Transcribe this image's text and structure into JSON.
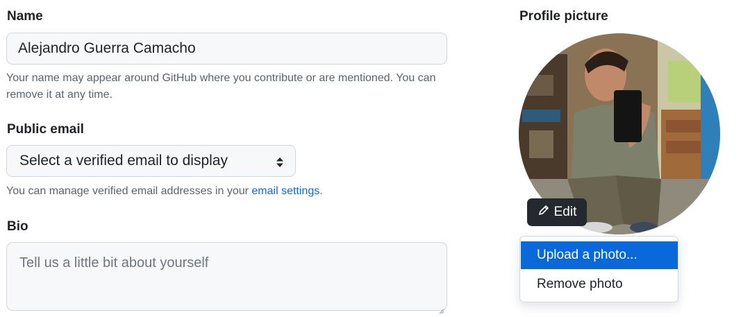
{
  "name_section": {
    "label": "Name",
    "value": "Alejandro Guerra Camacho",
    "note_line1": "Your name may appear around GitHub where you contribute or are mentioned. You can",
    "note_line2": "remove it at any time."
  },
  "email_section": {
    "label": "Public email",
    "selected": "Select a verified email to display",
    "note_prefix": "You can manage verified email addresses in your ",
    "note_link": "email settings",
    "note_suffix": "."
  },
  "bio_section": {
    "label": "Bio",
    "placeholder": "Tell us a little bit about yourself"
  },
  "profile": {
    "label": "Profile picture",
    "edit_label": "Edit",
    "menu": [
      "Upload a photo...",
      "Remove photo"
    ]
  },
  "colors": {
    "accent": "#0969da",
    "dark_button": "#24292f",
    "input_bg": "#f6f8fa",
    "border": "#d0d7de"
  },
  "icons": {
    "select": "chevron-up-down-icon",
    "edit": "pencil-icon",
    "resize": "resize-grip-icon"
  }
}
